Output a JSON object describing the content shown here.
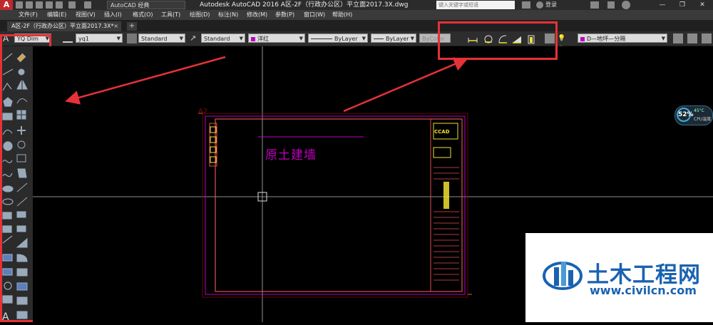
{
  "app": {
    "title": "Autodesk AutoCAD 2016    A区-2F（行政办公区）平立面2017.3X.dwg",
    "logo_text": "A",
    "workspace": "AutoCAD 经典",
    "search_placeholder": "键入关键字或短语",
    "login_label": "登录"
  },
  "menu": [
    "文件(F)",
    "编辑(E)",
    "视图(V)",
    "插入(I)",
    "格式(O)",
    "工具(T)",
    "绘图(D)",
    "标注(N)",
    "修改(M)",
    "参数(P)",
    "窗口(W)",
    "帮助(H)"
  ],
  "doc_tab": {
    "label": "A区-2F（行政办公区）平立面2017.3X*",
    "close": "×",
    "add": "+"
  },
  "toolbar": {
    "text_style": "YQ Dim",
    "dim_style": "yq1",
    "table_style": "Standard",
    "multileader_style": "Standard",
    "color": "洋红",
    "linetype": "ByLayer",
    "lineweight": "ByLayer",
    "plotstyle": "ByColor",
    "layer": "D—地坪—分隔"
  },
  "drawing": {
    "sheet_label": "A2",
    "wall_label": "原土建墙",
    "title_block_logo": "CCAD"
  },
  "cpu_widget": {
    "percent": "52%",
    "temp": "45°C",
    "label": "CPU温度"
  },
  "watermark": {
    "brand": "土木工程网",
    "url": "www.civilcn.com"
  },
  "colors": {
    "accent_red": "#e53238",
    "magenta": "#c000c0",
    "yellow": "#f0e030",
    "brand_blue": "#1a62b0"
  }
}
